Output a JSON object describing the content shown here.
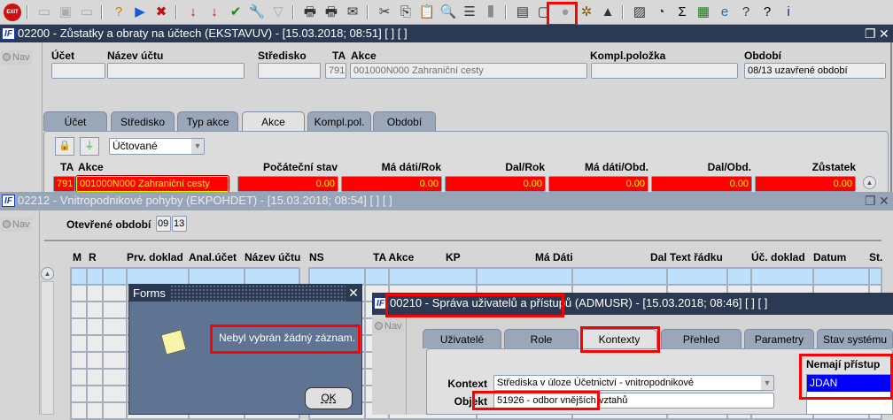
{
  "toolbar": {
    "icons": [
      "exit-icon",
      "sep",
      "insert-record-icon",
      "duplicate-record-icon",
      "delete-record-icon",
      "sep",
      "enter-query-icon",
      "execute-query-icon",
      "cancel-query-icon",
      "sep",
      "sort-ascending-icon",
      "sort-descending-icon",
      "commit-check-icon",
      "tools-wrench-icon",
      "filter-icon",
      "sep",
      "print-icon",
      "print-setup-icon",
      "mail-icon",
      "sep",
      "cut-icon",
      "copy-icon",
      "paste-icon",
      "search-zoom-icon",
      "indent-icon",
      "columns-icon",
      "sep",
      "export-form-icon",
      "document-icon",
      "globe-icon",
      "ship-wheel-icon",
      "home-alert-icon",
      "sep",
      "chart-icon",
      "clock-icon",
      "sum-icon",
      "excel-icon",
      "ie-browser-icon",
      "help-book-icon",
      "help-icon",
      "info-icon"
    ],
    "exit_label": "EXIT"
  },
  "win1": {
    "title": "02200 - Zůstatky a obraty na účtech (EKSTAVUV) - [15.03.2018; 08:51]  [ ]  [ ]",
    "logo": "IF",
    "nav": "Nav",
    "labels": {
      "ucet": "Účet",
      "nazev": "Název účtu",
      "stredisko": "Středisko",
      "ta": "TA",
      "akce": "Akce",
      "kompl": "Kompl.položka",
      "obdobi": "Období"
    },
    "values": {
      "ucet": "",
      "nazev": "",
      "stredisko": "",
      "ta": "791",
      "akce": "001000N000 Zahraniční cesty",
      "kompl": "",
      "obdobi": "08/13 uzavřené období"
    },
    "tabs": [
      "Účet",
      "Středisko",
      "Typ akce",
      "Akce",
      "Kompl.pol.",
      "Období"
    ],
    "active_tab": "Akce",
    "filter_select": "Účtované",
    "grid_headers": {
      "ta": "TA",
      "akce": "Akce",
      "poc": "Počáteční stav",
      "mdrok": "Má dáti/Rok",
      "dalrok": "Dal/Rok",
      "mdobd": "Má dáti/Obd.",
      "dalobd": "Dal/Obd.",
      "zust": "Zůstatek"
    },
    "row": {
      "ta": "791",
      "akce": "001000N000 Zahraniční cesty",
      "poc": "0.00",
      "mdrok": "0.00",
      "dalrok": "0.00",
      "mdobd": "0.00",
      "dalobd": "0.00",
      "zust": "0.00"
    }
  },
  "win2": {
    "title": "02212 - Vnitropodnikové pohyby (EKPOHDET) - [15.03.2018; 08:54]  [ ]  [ ]",
    "logo": "IF",
    "nav": "Nav",
    "period_label": "Otevřené období",
    "period_from": "09",
    "period_to": "13",
    "headers": {
      "m": "M",
      "r": "R",
      "prv": "Prv. doklad",
      "anal": "Anal.účet",
      "nazev": "Název účtu",
      "ns": "NS",
      "taakce": "TA Akce",
      "kp": "KP",
      "madati": "Má Dáti",
      "daltext": "Dal Text řádku",
      "ucdoklad": "Úč. doklad",
      "datum": "Datum",
      "st": "St."
    }
  },
  "dialog": {
    "title": "Forms",
    "message": "Nebyl vybrán žádný záznam.",
    "ok": "OK"
  },
  "win3": {
    "title": "00210 - Správa uživatelů a přístupů (ADMUSR) - [15.03.2018; 08:46]  [ ]  [ ]",
    "logo": "IF",
    "nav": "Nav",
    "tabs": [
      "Uživatelé",
      "Role",
      "Kontexty",
      "Přehled",
      "Parametry",
      "Stav systému"
    ],
    "active_tab": "Kontexty",
    "kontext_label": "Kontext",
    "kontext_value": "Střediska v úloze Účetnictví - vnitropodnikové",
    "objekt_label": "Objekt",
    "objekt_value": "51926 - odbor vnějších vztahů",
    "no_access_label": "Nemají přístup",
    "no_access_items": [
      "JDAN"
    ]
  },
  "colors": {
    "highlight": "#ff0000",
    "selected": "#0000ff",
    "title_active": "#2b3a52",
    "title_inactive": "#97a5b8"
  }
}
